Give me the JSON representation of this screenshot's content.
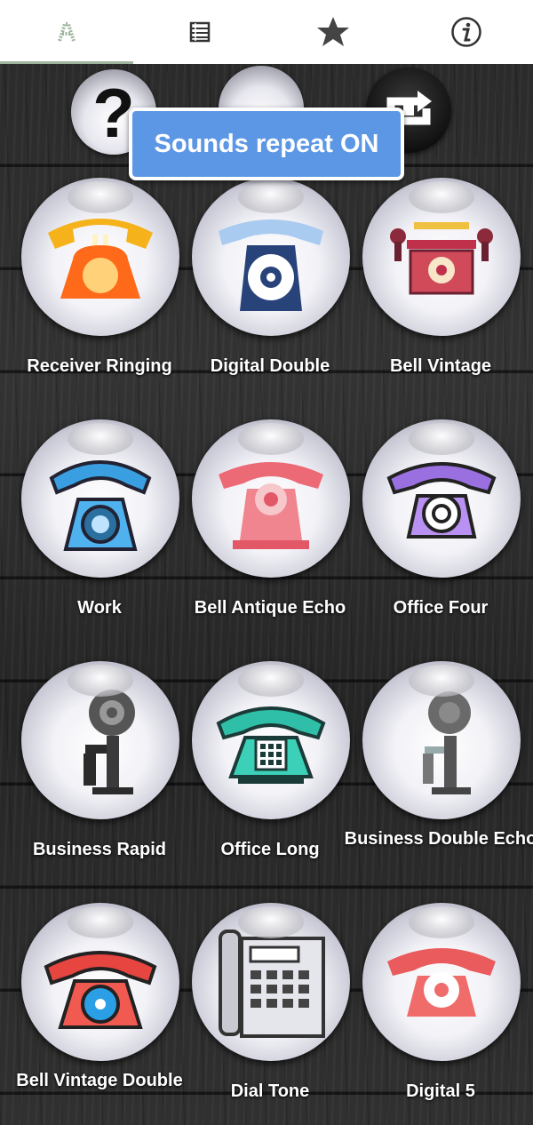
{
  "tabs": [
    {
      "name": "tab-sounds",
      "icon": "text-a-icon",
      "active": true
    },
    {
      "name": "tab-list",
      "icon": "list-icon",
      "active": false
    },
    {
      "name": "tab-favorites",
      "icon": "star-icon",
      "active": false
    },
    {
      "name": "tab-info",
      "icon": "info-icon",
      "active": false
    }
  ],
  "top_controls": [
    {
      "icon": "help-icon"
    },
    {
      "icon": "stop-icon"
    },
    {
      "icon": "repeat-icon"
    }
  ],
  "toast": {
    "text": "Sounds repeat ON"
  },
  "sounds": [
    {
      "label": "Receiver Ringing",
      "icon": "yellow-orange-phone-icon"
    },
    {
      "label": "Digital Double",
      "icon": "navy-rotary-phone-icon"
    },
    {
      "label": "Bell Vintage",
      "icon": "vintage-bell-phone-icon"
    },
    {
      "label": "Work",
      "icon": "blue-phone-icon"
    },
    {
      "label": "Bell Antique Echo",
      "icon": "red-antique-phone-icon"
    },
    {
      "label": "Office Four",
      "icon": "purple-phone-icon"
    },
    {
      "label": "Business Rapid",
      "icon": "candlestick-phone-icon"
    },
    {
      "label": "Office Long",
      "icon": "teal-keypad-phone-icon"
    },
    {
      "label": "Business Double Echo",
      "icon": "faded-candlestick-phone-icon"
    },
    {
      "label": "Bell Vintage Double",
      "icon": "red-blue-phone-icon"
    },
    {
      "label": "Dial Tone",
      "icon": "office-desk-phone-icon"
    },
    {
      "label": "Digital 5",
      "icon": "coral-rotary-phone-icon"
    }
  ],
  "colors": {
    "toast": "#5c97e6",
    "tab_indicator": "#9db59d"
  }
}
